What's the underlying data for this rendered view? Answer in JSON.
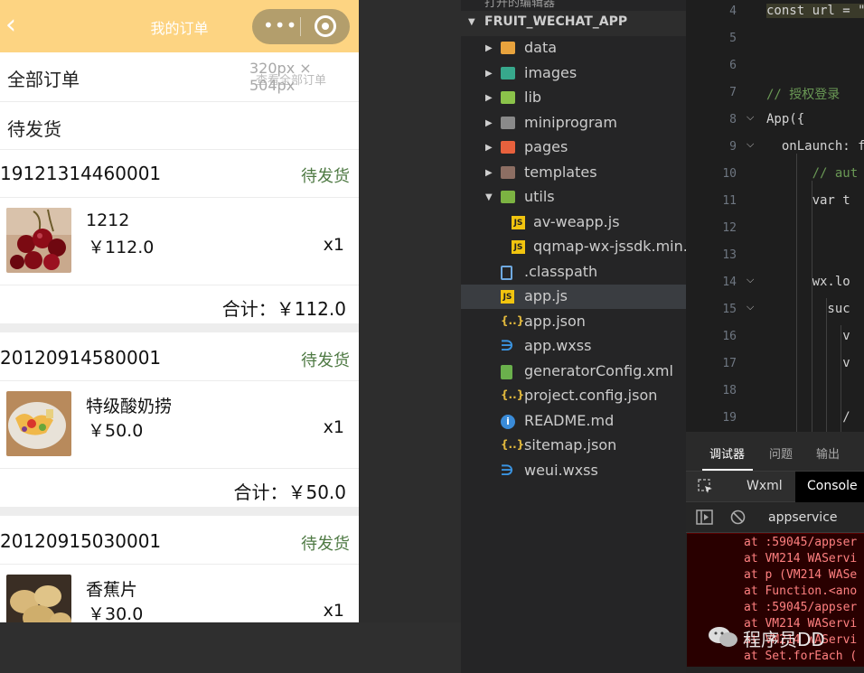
{
  "simulator": {
    "nav_title": "我的订单",
    "back_icon": "chevron-left-icon",
    "capsule_more": "•••",
    "size_overlay": "320px × 504px",
    "view_all": "查看全部订单",
    "tab_all": "全部订单",
    "tab_pending": "待发货",
    "orders": [
      {
        "no": "19121314460001",
        "status": "待发货",
        "name": "1212",
        "price": "￥112.0",
        "qty": "x1",
        "total": "合计：￥112.0"
      },
      {
        "no": "20120914580001",
        "status": "待发货",
        "name": "特级酸奶捞",
        "price": "￥50.0",
        "qty": "x1",
        "total": "合计：￥50.0"
      },
      {
        "no": "20120915030001",
        "status": "待发货",
        "name": "香蕉片",
        "price": "￥30.0",
        "qty": "x1"
      }
    ]
  },
  "explorer": {
    "open_editors": "打开的编辑器",
    "project": "FRUIT_WECHAT_APP",
    "items": [
      {
        "label": "data",
        "type": "folder",
        "color": "#e8a33d"
      },
      {
        "label": "images",
        "type": "folder",
        "color": "#37a88c"
      },
      {
        "label": "lib",
        "type": "folder",
        "color": "#8bc34a"
      },
      {
        "label": "miniprogram",
        "type": "folder",
        "color": "#8a8a8a"
      },
      {
        "label": "pages",
        "type": "folder",
        "color": "#e8613d"
      },
      {
        "label": "templates",
        "type": "folder",
        "color": "#8d6e63"
      },
      {
        "label": "utils",
        "type": "folder-open",
        "color": "#7cb342"
      },
      {
        "label": "av-weapp.js",
        "type": "js"
      },
      {
        "label": "qqmap-wx-jssdk.min.js",
        "type": "js"
      },
      {
        "label": ".classpath",
        "type": "file"
      },
      {
        "label": "app.js",
        "type": "js"
      },
      {
        "label": "app.json",
        "type": "json"
      },
      {
        "label": "app.wxss",
        "type": "css"
      },
      {
        "label": "generatorConfig.xml",
        "type": "xml"
      },
      {
        "label": "project.config.json",
        "type": "json"
      },
      {
        "label": "README.md",
        "type": "info"
      },
      {
        "label": "sitemap.json",
        "type": "json"
      },
      {
        "label": "weui.wxss",
        "type": "css"
      }
    ]
  },
  "editor": {
    "lines": [
      {
        "n": "4",
        "code": "const url = \""
      },
      {
        "n": "5",
        "code": ""
      },
      {
        "n": "6",
        "code": ""
      },
      {
        "n": "7",
        "code": "// 授权登录"
      },
      {
        "n": "8",
        "code": "App({"
      },
      {
        "n": "9",
        "code": "  onLaunch: f"
      },
      {
        "n": "10",
        "code": "      // aut"
      },
      {
        "n": "11",
        "code": "      var t"
      },
      {
        "n": "12",
        "code": ""
      },
      {
        "n": "13",
        "code": ""
      },
      {
        "n": "14",
        "code": "      wx.lo"
      },
      {
        "n": "15",
        "code": "        suc"
      },
      {
        "n": "16",
        "code": "          v"
      },
      {
        "n": "17",
        "code": "          v"
      },
      {
        "n": "18",
        "code": ""
      },
      {
        "n": "19",
        "code": "          /"
      }
    ]
  },
  "debug": {
    "tabs": [
      "调试器",
      "问题",
      "输出"
    ],
    "subtabs": [
      "Wxml",
      "Console"
    ],
    "context": "appservice",
    "errors": [
      "at :59045/appser",
      "at VM214 WAServi",
      "at p (VM214 WASe",
      "at Function.<ano",
      "at :59045/appser",
      "at VM214 WAServi",
      "at VM214 WAServi",
      "at Set.forEach ("
    ]
  },
  "watermark": {
    "text": "程序员DD",
    "icon": "wechat-icon"
  }
}
